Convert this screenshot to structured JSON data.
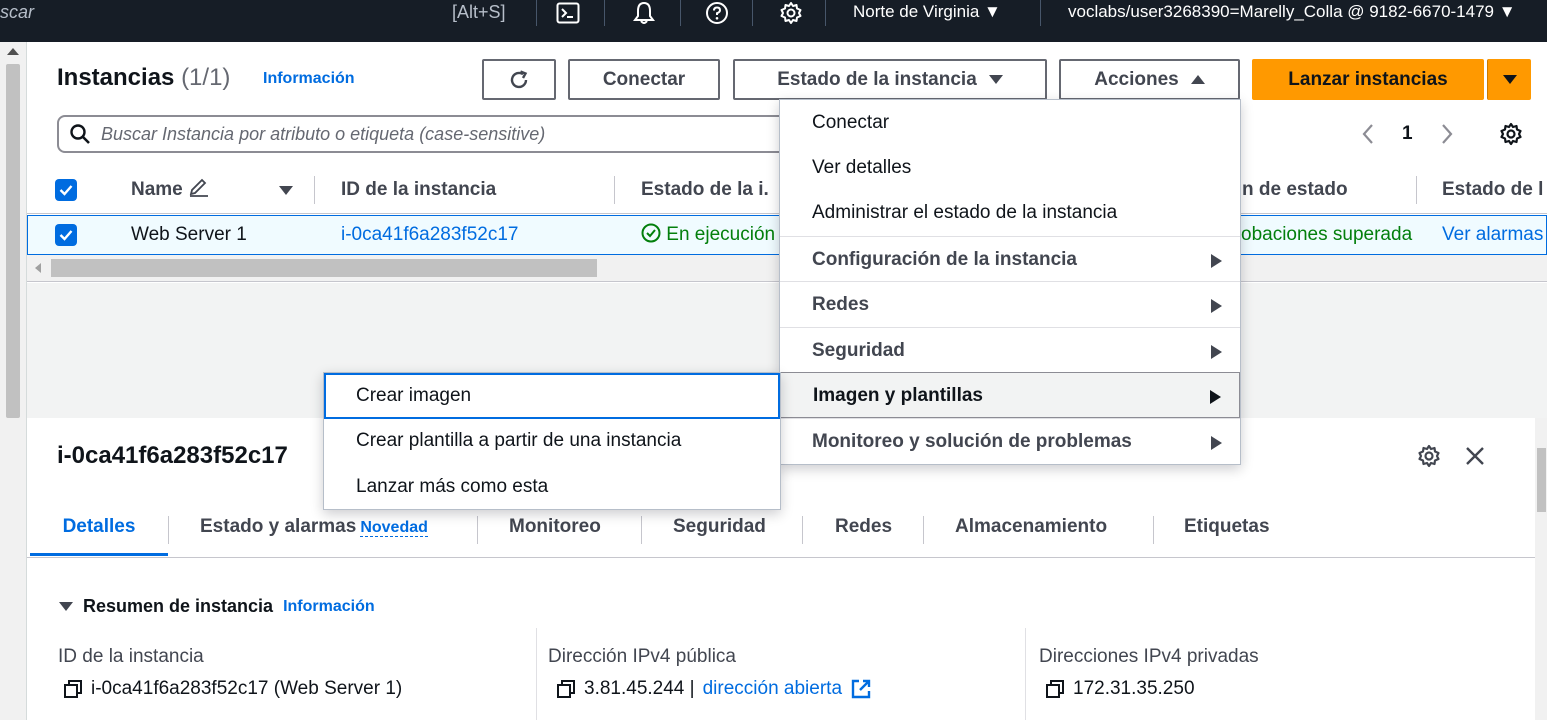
{
  "topbar": {
    "search_text": "scar",
    "search_shortcut": "[Alt+S]",
    "region": "Norte de Virginia",
    "account": "voclabs/user3268390=Marelly_Colla @ 9182-6670-1479"
  },
  "instances": {
    "title": "Instancias",
    "count": "(1/1)",
    "info": "Información",
    "buttons": {
      "connect": "Conectar",
      "instance_state": "Estado de la instancia",
      "actions": "Acciones",
      "launch": "Lanzar instancias"
    },
    "search_placeholder": "Buscar Instancia por atributo o etiqueta (case-sensitive)",
    "page": "1",
    "columns": [
      "Name",
      "ID de la instancia",
      "Estado de la i.",
      "n de estado",
      "Estado de l"
    ],
    "rows": [
      {
        "name": "Web Server 1",
        "id": "i-0ca41f6a283f52c17",
        "state": "En ejecución",
        "status_check": "obaciones superada",
        "alarms": "Ver alarmas"
      }
    ]
  },
  "actions_menu": {
    "items": [
      {
        "label": "Conectar",
        "type": "item"
      },
      {
        "label": "Ver detalles",
        "type": "item"
      },
      {
        "label": "Administrar el estado de la instancia",
        "type": "item"
      },
      {
        "label": "Configuración de la instancia",
        "type": "group"
      },
      {
        "label": "Redes",
        "type": "group"
      },
      {
        "label": "Seguridad",
        "type": "group"
      },
      {
        "label": "Imagen y plantillas",
        "type": "group",
        "highlighted": true
      },
      {
        "label": "Monitoreo y solución de problemas",
        "type": "group"
      }
    ]
  },
  "image_submenu": {
    "items": [
      {
        "label": "Crear imagen",
        "focused": true
      },
      {
        "label": "Crear plantilla a partir de una instancia"
      },
      {
        "label": "Lanzar más como esta"
      }
    ]
  },
  "details": {
    "title": "i-0ca41f6a283f52c17",
    "tabs": [
      "Detalles",
      "Estado y alarmas",
      "Monitoreo",
      "Seguridad",
      "Redes",
      "Almacenamiento",
      "Etiquetas"
    ],
    "tab_badge": "Novedad",
    "active_tab": "Detalles",
    "section": "Resumen de instancia",
    "section_info": "Información",
    "fields": [
      {
        "label": "ID de la instancia",
        "value": "i-0ca41f6a283f52c17 (Web Server 1)"
      },
      {
        "label": "Dirección IPv4 pública",
        "value": "3.81.45.244 |",
        "link": "dirección abierta"
      },
      {
        "label": "Direcciones IPv4 privadas",
        "value": "172.31.35.250"
      }
    ]
  },
  "colors": {
    "topbar_bg": "#161d26",
    "primary_orange": "#ff9900",
    "link_blue": "#006ce0",
    "success_green": "#037f0c"
  }
}
